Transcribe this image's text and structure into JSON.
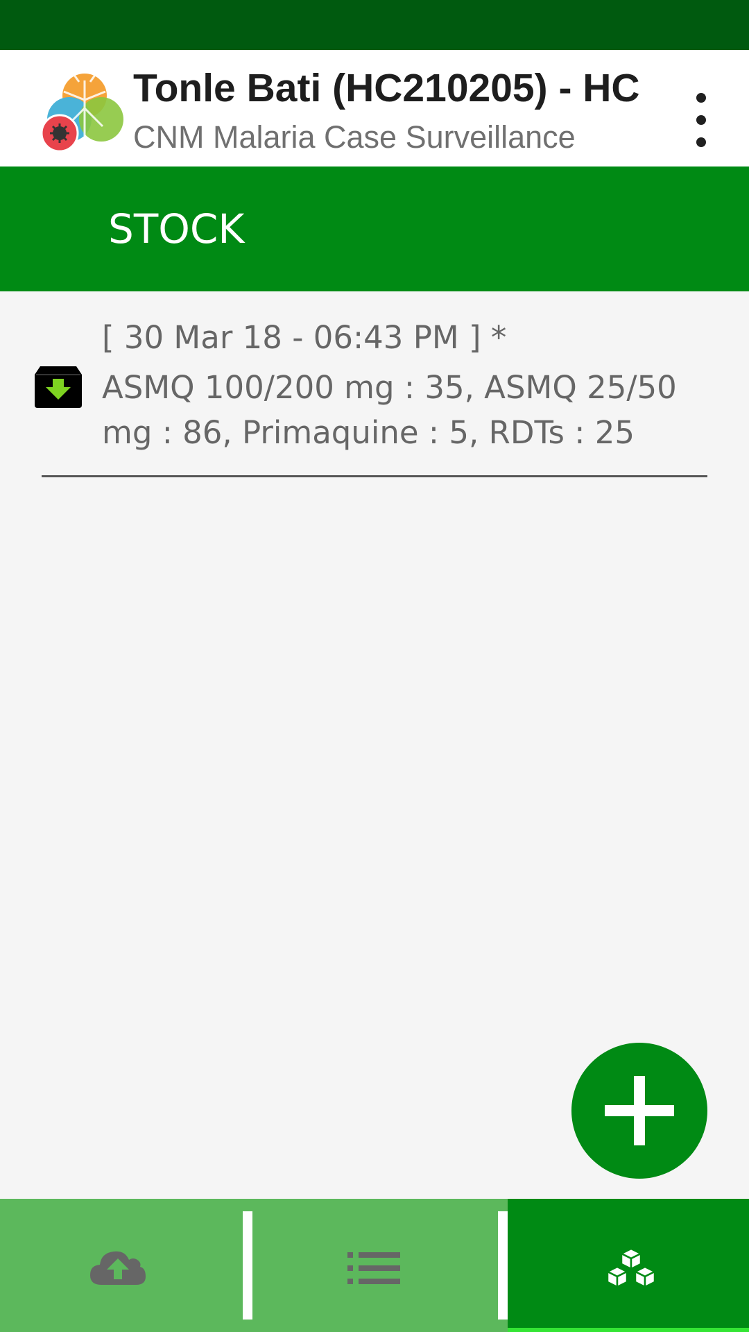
{
  "header": {
    "title": "Tonle Bati (HC210205) - HC",
    "subtitle": "CNM Malaria Case Surveillance",
    "menu_icon": "more-vert-icon",
    "logo_icon": "mosquito-logo-icon"
  },
  "section": {
    "title": "STOCK"
  },
  "stock_items": [
    {
      "date": "[ 30 Mar 18 - 06:43 PM ] *",
      "details": "ASMQ 100/200 mg : 35, ASMQ 25/50 mg : 86, Primaquine : 5, RDTs : 25",
      "icon": "inbox-download-icon"
    }
  ],
  "fab": {
    "icon": "plus-icon"
  },
  "bottom_nav": {
    "tabs": [
      {
        "icon": "cloud-upload-icon",
        "active": false
      },
      {
        "icon": "list-icon",
        "active": false
      },
      {
        "icon": "cubes-icon",
        "active": true
      }
    ]
  },
  "colors": {
    "status_bar": "#005a0f",
    "primary": "#008a14",
    "nav_background": "#5cb85c",
    "active_indicator": "#34e534",
    "icon_accent": "#7ed321"
  }
}
